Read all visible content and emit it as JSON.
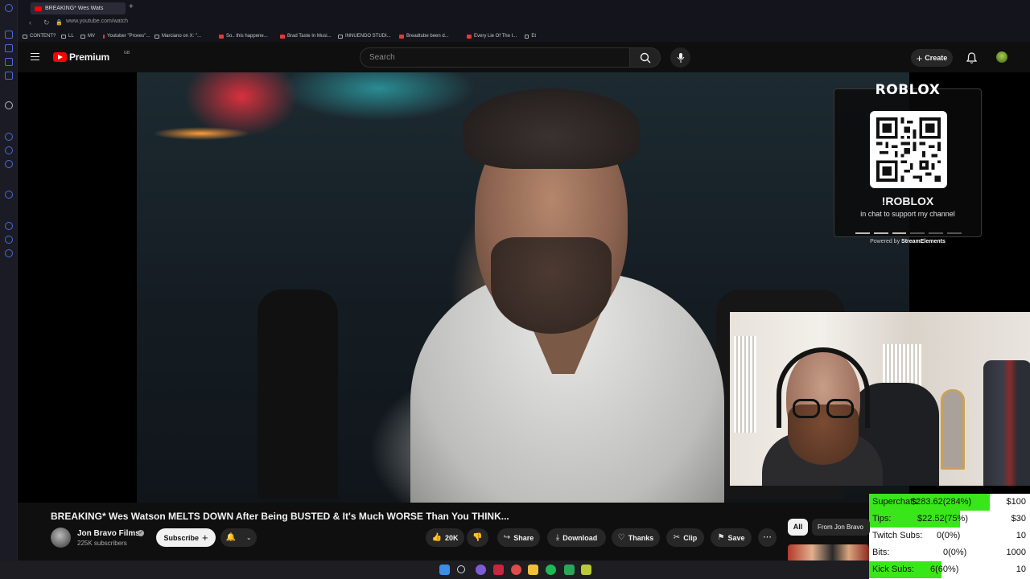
{
  "browser": {
    "tab_title": "BREAKING* Wes Wats",
    "url": "www.youtube.com/watch",
    "bookmarks": [
      {
        "label": "CONTENT?",
        "icon": "folder"
      },
      {
        "label": "LL",
        "icon": "site"
      },
      {
        "label": "MV",
        "icon": "site"
      },
      {
        "label": "Youtuber \"Proves\"...",
        "icon": "youtube"
      },
      {
        "label": "Marciano on X: \"...",
        "icon": "x"
      },
      {
        "label": "So.. this happene...",
        "icon": "youtube"
      },
      {
        "label": "Brad Taste In Musi...",
        "icon": "youtube"
      },
      {
        "label": "INNUENDO STUDI...",
        "icon": "folder"
      },
      {
        "label": "Breadtube been d...",
        "icon": "youtube"
      },
      {
        "label": "Every Lie Of The I...",
        "icon": "youtube"
      },
      {
        "label": "Et",
        "icon": "folder"
      }
    ]
  },
  "header": {
    "logo_text": "Premium",
    "region": "GB",
    "search_placeholder": "Search",
    "create_label": "Create"
  },
  "overlay": {
    "brand": "ROBLOX",
    "command": "!ROBLOX",
    "subtitle": "in chat to support my channel",
    "powered_prefix": "Powered by",
    "powered_brand": "StreamElements"
  },
  "stats": {
    "rows": [
      {
        "label": "Superchats:",
        "value": "$283.62(284%)",
        "goal": "$100",
        "fill": 1.0
      },
      {
        "label": "Tips:",
        "value": "$22.52(75%)",
        "goal": "$30",
        "fill": 0.75
      },
      {
        "label": "Twitch Subs:",
        "value": "0(0%)",
        "goal": "10",
        "fill": 0
      },
      {
        "label": "Bits:",
        "value": "0(0%)",
        "goal": "1000",
        "fill": 0
      },
      {
        "label": "Kick Subs:",
        "value": "6(60%)",
        "goal": "10",
        "fill": 0.6
      }
    ],
    "bar_color": "#39e619"
  },
  "video": {
    "title": "BREAKING* Wes Watson MELTS DOWN After Being BUSTED & It's Much WORSE Than You THINK...",
    "channel": "Jon Bravo Films",
    "subscribers": "225K subscribers",
    "subscribe_label": "Subscribe",
    "likes": "20K",
    "share_label": "Share",
    "download_label": "Download",
    "thanks_label": "Thanks",
    "clip_label": "Clip",
    "save_label": "Save"
  },
  "chips": {
    "all": "All",
    "from": "From Jon Bravo"
  },
  "colors": {
    "youtube_red": "#ff0000",
    "background": "#0f0f0f"
  }
}
